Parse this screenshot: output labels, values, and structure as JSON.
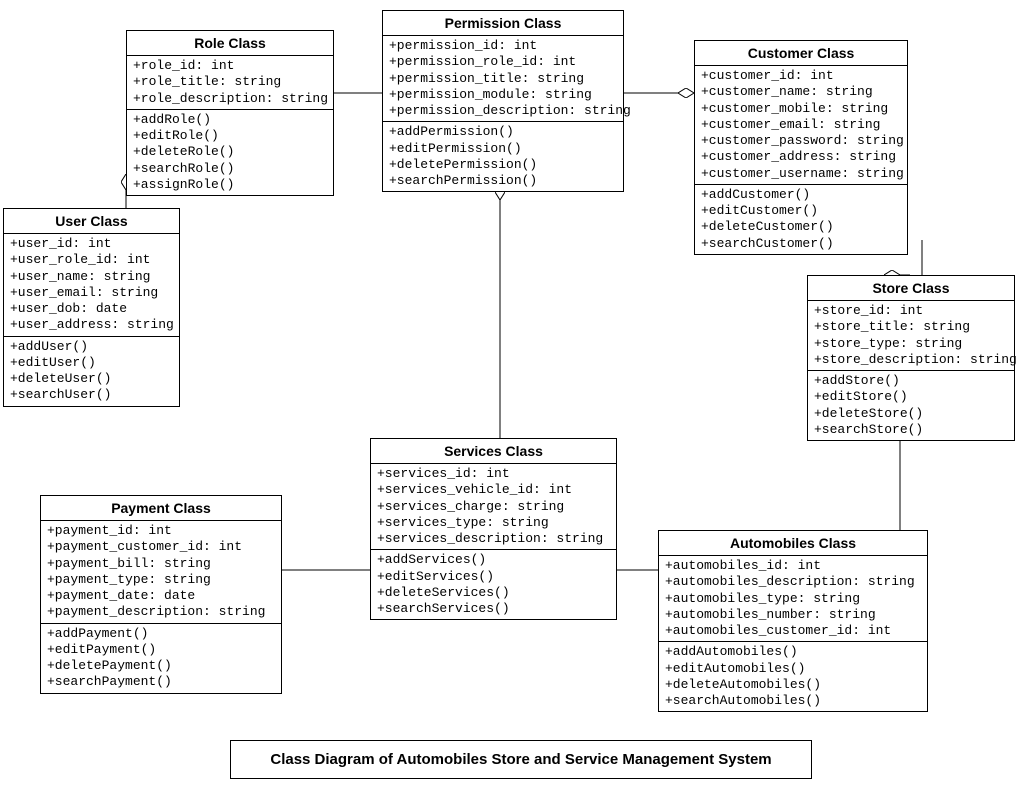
{
  "caption": "Class Diagram of Automobiles Store and Service Management System",
  "classes": {
    "role": {
      "title": "Role Class",
      "attrs": [
        "+role_id: int",
        "+role_title: string",
        "+role_description: string"
      ],
      "ops": [
        "+addRole()",
        "+editRole()",
        "+deleteRole()",
        "+searchRole()",
        "+assignRole()"
      ]
    },
    "permission": {
      "title": "Permission Class",
      "attrs": [
        "+permission_id: int",
        "+permission_role_id: int",
        "+permission_title: string",
        "+permission_module: string",
        "+permission_description: string"
      ],
      "ops": [
        "+addPermission()",
        "+editPermission()",
        "+deletePermission()",
        "+searchPermission()"
      ]
    },
    "customer": {
      "title": "Customer Class",
      "attrs": [
        "+customer_id: int",
        "+customer_name: string",
        "+customer_mobile: string",
        "+customer_email: string",
        "+customer_password: string",
        "+customer_address: string",
        "+customer_username: string"
      ],
      "ops": [
        "+addCustomer()",
        "+editCustomer()",
        "+deleteCustomer()",
        "+searchCustomer()"
      ]
    },
    "user": {
      "title": "User Class",
      "attrs": [
        "+user_id: int",
        "+user_role_id: int",
        "+user_name: string",
        "+user_email: string",
        "+user_dob: date",
        "+user_address: string"
      ],
      "ops": [
        "+addUser()",
        "+editUser()",
        "+deleteUser()",
        "+searchUser()"
      ]
    },
    "store": {
      "title": "Store Class",
      "attrs": [
        "+store_id: int",
        "+store_title: string",
        "+store_type: string",
        "+store_description: string"
      ],
      "ops": [
        "+addStore()",
        "+editStore()",
        "+deleteStore()",
        "+searchStore()"
      ]
    },
    "services": {
      "title": "Services Class",
      "attrs": [
        "+services_id: int",
        "+services_vehicle_id: int",
        "+services_charge: string",
        "+services_type: string",
        "+services_description: string"
      ],
      "ops": [
        "+addServices()",
        "+editServices()",
        "+deleteServices()",
        "+searchServices()"
      ]
    },
    "payment": {
      "title": "Payment Class",
      "attrs": [
        "+payment_id: int",
        "+payment_customer_id: int",
        "+payment_bill: string",
        "+payment_type: string",
        "+payment_date: date",
        "+payment_description: string"
      ],
      "ops": [
        "+addPayment()",
        "+editPayment()",
        "+deletePayment()",
        "+searchPayment()"
      ]
    },
    "automobiles": {
      "title": "Automobiles Class",
      "attrs": [
        "+automobiles_id: int",
        "+automobiles_description: string",
        "+automobiles_type: string",
        "+automobiles_number: string",
        "+automobiles_customer_id: int"
      ],
      "ops": [
        "+addAutomobiles()",
        "+editAutomobiles()",
        "+deleteAutomobiles()",
        "+searchAutomobiles()"
      ]
    }
  }
}
